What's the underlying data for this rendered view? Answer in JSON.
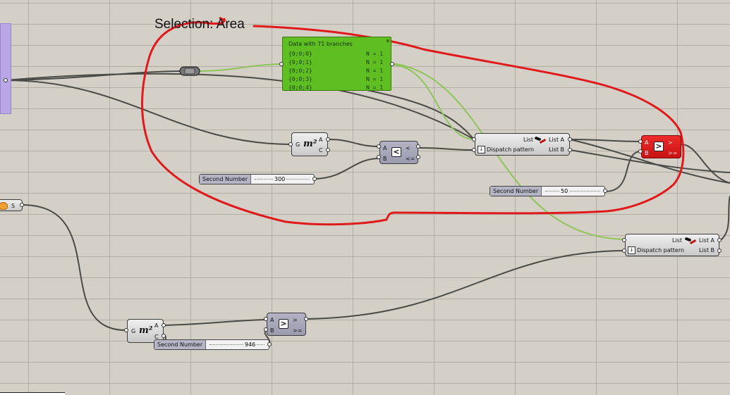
{
  "canvas": {
    "group_title": "Selection: Area"
  },
  "panel": {
    "title": "Data with 71 branches",
    "rows": [
      {
        "path": "{0;0;0}",
        "count": "N = 1"
      },
      {
        "path": "{0;0;1}",
        "count": "N = 1"
      },
      {
        "path": "{0;0;2}",
        "count": "N = 1"
      },
      {
        "path": "{0;0;3}",
        "count": "N = 1"
      },
      {
        "path": "{0;0;4}",
        "count": "N = 1"
      }
    ],
    "color": "#5fbf22"
  },
  "area_top": {
    "icon": "m²",
    "in": "G",
    "out_a": "A",
    "out_c": "C"
  },
  "area_bottom": {
    "icon": "m²",
    "in": "G",
    "out_a": "A",
    "out_c": "C"
  },
  "less_than": {
    "in_a": "A",
    "in_b": "B",
    "op": "<",
    "out_lt": "<",
    "out_le": "<="
  },
  "greater_top": {
    "in_a": "A",
    "in_b": "B",
    "op": ">",
    "out_gt": ">",
    "out_ge": ">=",
    "color": "#e0191b"
  },
  "greater_bottom": {
    "in_a": "A",
    "in_b": "B",
    "op": ">",
    "out_gt": ">",
    "out_ge": ">="
  },
  "dispatch_top": {
    "in_list": "List",
    "in_pattern": "Dispatch pattern",
    "out_a": "List A",
    "out_b": "List B"
  },
  "dispatch_bottom": {
    "in_list": "List",
    "in_pattern": "Dispatch pattern",
    "out_a": "List A",
    "out_b": "List B"
  },
  "slider_300": {
    "name": "Second Number",
    "value": "300"
  },
  "slider_50": {
    "name": "Second Number",
    "value": "50"
  },
  "slider_946": {
    "name": "Second Number",
    "value": "946"
  },
  "left_param": {
    "label": "S"
  },
  "colors": {
    "annotation": "#e0191b",
    "wire": "#4a4a46",
    "wire_selected": "#8fc45a"
  }
}
